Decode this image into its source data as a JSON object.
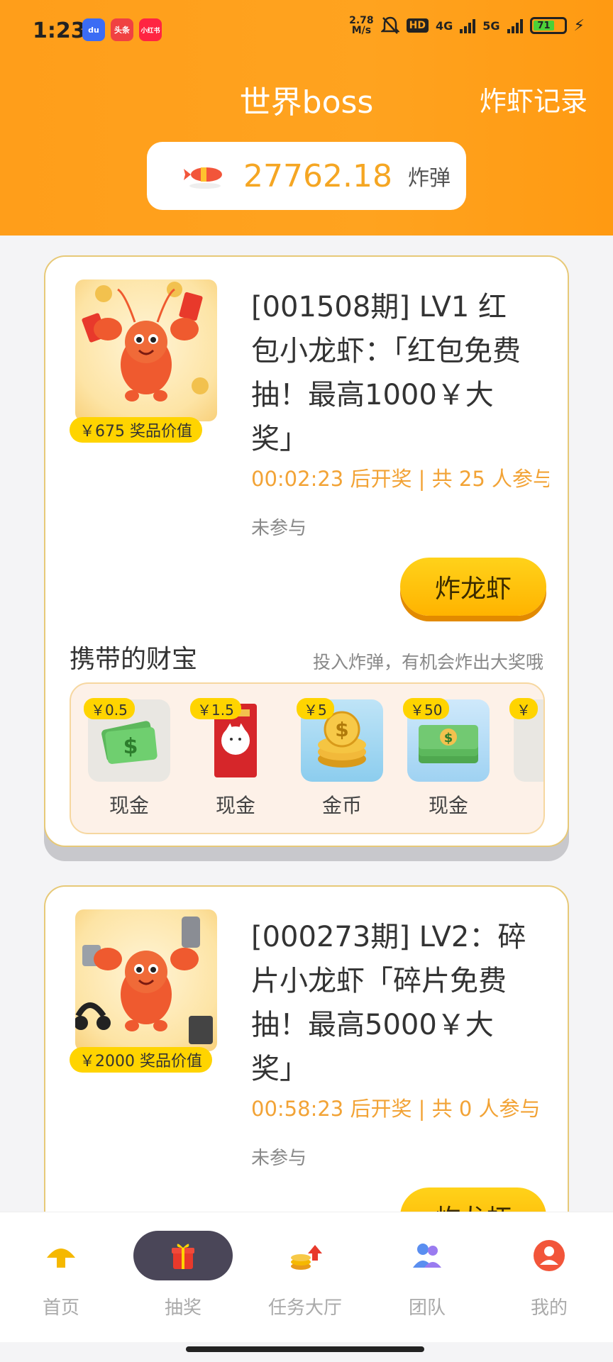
{
  "status_bar": {
    "time": "1:23",
    "apps": [
      {
        "name": "baidu",
        "color": "#3b6cf4",
        "text": "du"
      },
      {
        "name": "toutiao",
        "color": "#f04142",
        "text": "头条"
      },
      {
        "name": "xiaohongshu",
        "color": "#ff2442",
        "text": "小红书"
      }
    ],
    "net_speed_value": "2.78",
    "net_speed_unit": "M/s",
    "hd": "HD",
    "network": "4G",
    "network2": "5G",
    "battery": "71"
  },
  "header": {
    "title": "世界boss",
    "record_link": "炸虾记录",
    "bomb_value": "27762.18",
    "bomb_unit": "炸弹"
  },
  "cards": [
    {
      "title": "[001508期] LV1 红包小龙虾：「红包免费抽！最高1000￥大奖」",
      "prize_tag": "￥675 奖品价值",
      "countdown": "00:02:23 后开奖 | 共 25 人参与",
      "status": "未参与",
      "button": "炸龙虾",
      "treasure_title": "携带的财宝",
      "treasure_hint": "投入炸弹，有机会炸出大奖哦",
      "treasures": [
        {
          "price": "￥0.5",
          "label": "现金",
          "icon": "cash-icon"
        },
        {
          "price": "￥1.5",
          "label": "现金",
          "icon": "red-envelope-icon"
        },
        {
          "price": "￥5",
          "label": "金币",
          "icon": "gold-coins-icon"
        },
        {
          "price": "￥50",
          "label": "现金",
          "icon": "cash-stack-icon"
        },
        {
          "price": "￥",
          "label": "",
          "icon": "cash-icon"
        }
      ]
    },
    {
      "title": "[000273期] LV2：碎片小龙虾「碎片免费抽！最高5000￥大奖」",
      "prize_tag": "￥2000 奖品价值",
      "countdown": "00:58:23 后开奖 | 共 0 人参与",
      "status": "未参与",
      "button": "炸龙虾"
    }
  ],
  "bottom_nav": [
    {
      "label": "首页",
      "icon": "home-icon",
      "active": false
    },
    {
      "label": "抽奖",
      "icon": "gift-icon",
      "active": true
    },
    {
      "label": "任务大厅",
      "icon": "task-hall-icon",
      "active": false
    },
    {
      "label": "团队",
      "icon": "team-icon",
      "active": false
    },
    {
      "label": "我的",
      "icon": "profile-icon",
      "active": false
    }
  ],
  "colors": {
    "header_orange": "#ffa31f",
    "accent_yellow": "#ffd400",
    "countdown_orange": "#f2a336",
    "nav_active": "#4a4658"
  }
}
